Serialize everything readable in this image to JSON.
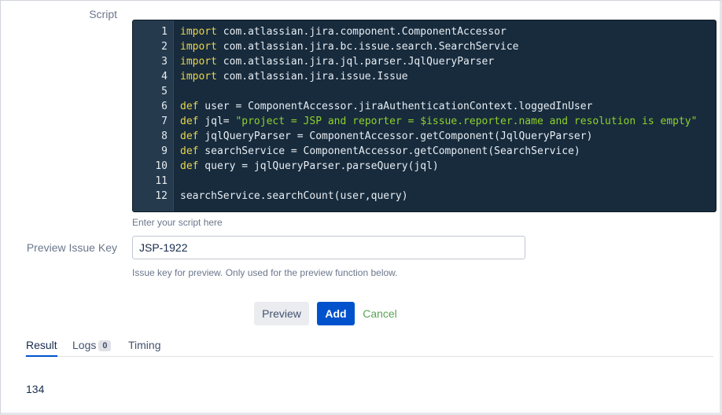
{
  "labels": {
    "script": "Script",
    "preview_issue_key": "Preview Issue Key"
  },
  "editor": {
    "lines": [
      {
        "num": "1",
        "parts": [
          {
            "t": "import",
            "c": "kw"
          },
          {
            "t": " com.atlassian.jira.component.ComponentAccessor",
            "c": ""
          }
        ]
      },
      {
        "num": "2",
        "parts": [
          {
            "t": "import",
            "c": "kw"
          },
          {
            "t": " com.atlassian.jira.bc.issue.search.SearchService",
            "c": ""
          }
        ]
      },
      {
        "num": "3",
        "parts": [
          {
            "t": "import",
            "c": "kw"
          },
          {
            "t": " com.atlassian.jira.jql.parser.JqlQueryParser",
            "c": ""
          }
        ]
      },
      {
        "num": "4",
        "parts": [
          {
            "t": "import",
            "c": "kw"
          },
          {
            "t": " com.atlassian.jira.issue.Issue",
            "c": ""
          }
        ]
      },
      {
        "num": "5",
        "parts": []
      },
      {
        "num": "6",
        "parts": [
          {
            "t": "def",
            "c": "kw"
          },
          {
            "t": " user = ComponentAccessor.jiraAuthenticationContext.loggedInUser",
            "c": ""
          }
        ]
      },
      {
        "num": "7",
        "parts": [
          {
            "t": "def",
            "c": "kw"
          },
          {
            "t": " jql= ",
            "c": ""
          },
          {
            "t": "\"project = JSP and reporter = $issue.reporter.name and resolution is empty\"",
            "c": "str"
          }
        ]
      },
      {
        "num": "8",
        "parts": [
          {
            "t": "def",
            "c": "kw"
          },
          {
            "t": " jqlQueryParser = ComponentAccessor.getComponent(JqlQueryParser)",
            "c": ""
          }
        ]
      },
      {
        "num": "9",
        "parts": [
          {
            "t": "def",
            "c": "kw"
          },
          {
            "t": " searchService = ComponentAccessor.getComponent(SearchService)",
            "c": ""
          }
        ]
      },
      {
        "num": "10",
        "parts": [
          {
            "t": "def",
            "c": "kw"
          },
          {
            "t": " query = jqlQueryParser.parseQuery(jql)",
            "c": ""
          }
        ]
      },
      {
        "num": "11",
        "parts": []
      },
      {
        "num": "12",
        "parts": [
          {
            "t": "searchService.searchCount(user,query)",
            "c": ""
          }
        ]
      }
    ]
  },
  "help": {
    "script": "Enter your script here",
    "issue_key": "Issue key for preview. Only used for the preview function below."
  },
  "issue_key_input": {
    "value": "JSP-1922"
  },
  "buttons": {
    "preview": "Preview",
    "add": "Add",
    "cancel": "Cancel"
  },
  "tabs": {
    "result": "Result",
    "logs": "Logs",
    "logs_count": "0",
    "timing": "Timing"
  },
  "result": {
    "value": "134"
  },
  "colors": {
    "editor_bg": "#172b3d",
    "keyword": "#e8d44d",
    "string": "#8fd12a",
    "primary": "#0052cc",
    "cancel": "#5aa454"
  }
}
